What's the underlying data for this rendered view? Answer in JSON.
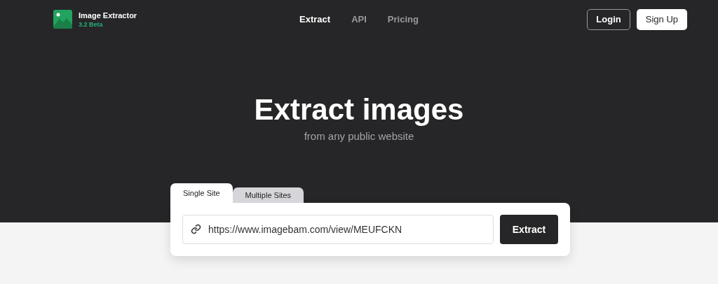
{
  "brand": {
    "name": "Image Extractor",
    "version": "3.2 Beta"
  },
  "nav": [
    {
      "label": "Extract",
      "selected": true
    },
    {
      "label": "API",
      "selected": false
    },
    {
      "label": "Pricing",
      "selected": false
    }
  ],
  "auth": {
    "login": "Login",
    "signup": "Sign Up"
  },
  "hero": {
    "title": "Extract images",
    "subtitle": "from any public website"
  },
  "tabs": [
    {
      "label": "Single Site",
      "selected": true
    },
    {
      "label": "Multiple Sites",
      "selected": false
    }
  ],
  "url_field": {
    "value": "https://www.imagebam.com/view/MEUFCKN"
  },
  "submit": "Extract"
}
